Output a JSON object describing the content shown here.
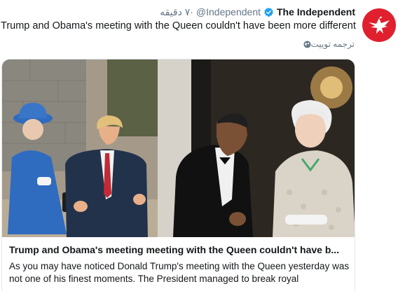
{
  "account": {
    "display_name": "The Independent",
    "handle": "@Independent",
    "time": "۷ دقیقه",
    "separator": "·"
  },
  "tweet": {
    "text": "Trump and Obama's meeting with the Queen couldn't have been more different",
    "translate_label": "ترجمه توییت"
  },
  "card": {
    "title": "Trump and Obama's meeting meeting with the Queen couldn't have b...",
    "description": "As you may have noticed Donald Trump's meeting with the Queen yesterday was not one of his finest moments. The President managed to break royal"
  },
  "icons": {
    "avatar": "independent-eagle-logo",
    "verified": "verified-badge-icon",
    "translate": "globe-icon"
  },
  "colors": {
    "brand_red": "#e0202e",
    "verified_blue": "#1da1f2",
    "muted_text": "#657786",
    "card_border": "#e1e8ed"
  }
}
